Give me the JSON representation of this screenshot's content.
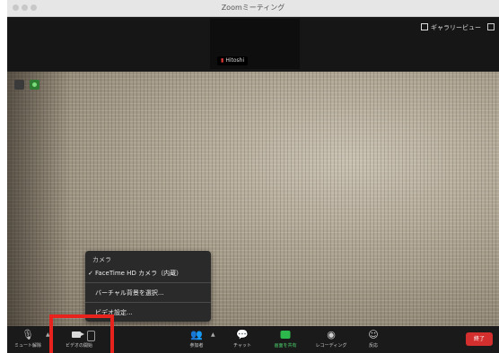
{
  "window": {
    "title": "Zoomミーティング"
  },
  "topbar": {
    "participant_name": "Hitoshi",
    "view_label": "ギャラリービュー",
    "icons": [
      "gallery-view-icon",
      "fullscreen-icon"
    ]
  },
  "video": {
    "badges": [
      "security-icon",
      "encryption-shield-icon"
    ]
  },
  "camera_menu": {
    "header": "カメラ",
    "check": "✓",
    "items": [
      "FaceTime HD カメラ（内蔵）",
      "バーチャル背景を選択...",
      "ビデオ設定..."
    ]
  },
  "toolbar": {
    "items": [
      {
        "label": "ミュート解除",
        "icon": "microphone-muted-icon"
      },
      {
        "label": "ビデオの開始",
        "icon": "video-camera-icon"
      },
      {
        "label": "参加者",
        "icon": "participants-icon"
      },
      {
        "label": "チャット",
        "icon": "chat-icon"
      },
      {
        "label": "画面を共有",
        "icon": "share-screen-icon"
      },
      {
        "label": "レコーディング",
        "icon": "record-icon"
      },
      {
        "label": "反応",
        "icon": "reaction-icon"
      }
    ],
    "end_label": "終了",
    "colors": {
      "share": "#2db84d",
      "end": "#d32f2f",
      "highlight": "#e8231d"
    }
  }
}
